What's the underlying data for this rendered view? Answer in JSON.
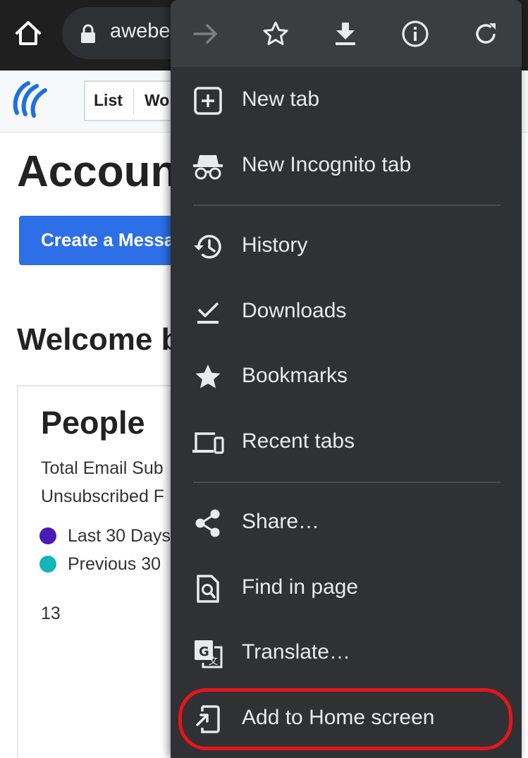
{
  "browser": {
    "url_text": "awebe"
  },
  "page": {
    "nav_items": [
      "List",
      "Wo"
    ],
    "account_title": "Accoun",
    "create_button": "Create a Messa",
    "welcome_heading": "Welcome b",
    "people": {
      "title": "People",
      "stats": [
        "Total Email Sub",
        "Unsubscribed F"
      ],
      "legend": [
        {
          "label": "Last 30 Days",
          "color": "#4a1ab8"
        },
        {
          "label": "Previous 30",
          "color": "#13b5b8"
        }
      ],
      "count": "13"
    },
    "brand_color": "#1f6fe0"
  },
  "menu": {
    "toolbar_icons": [
      "forward-icon",
      "bookmark-star-icon",
      "download-icon",
      "info-icon",
      "reload-icon"
    ],
    "items": [
      {
        "label": "New tab",
        "icon": "new-tab-icon"
      },
      {
        "label": "New Incognito tab",
        "icon": "incognito-icon"
      },
      {
        "label": "History",
        "icon": "history-icon"
      },
      {
        "label": "Downloads",
        "icon": "downloads-icon"
      },
      {
        "label": "Bookmarks",
        "icon": "star-icon"
      },
      {
        "label": "Recent tabs",
        "icon": "devices-icon"
      },
      {
        "label": "Share…",
        "icon": "share-icon"
      },
      {
        "label": "Find in page",
        "icon": "find-in-page-icon"
      },
      {
        "label": "Translate…",
        "icon": "translate-icon"
      },
      {
        "label": "Add to Home screen",
        "icon": "add-to-home-icon"
      }
    ],
    "highlight_color": "#e8141b"
  }
}
